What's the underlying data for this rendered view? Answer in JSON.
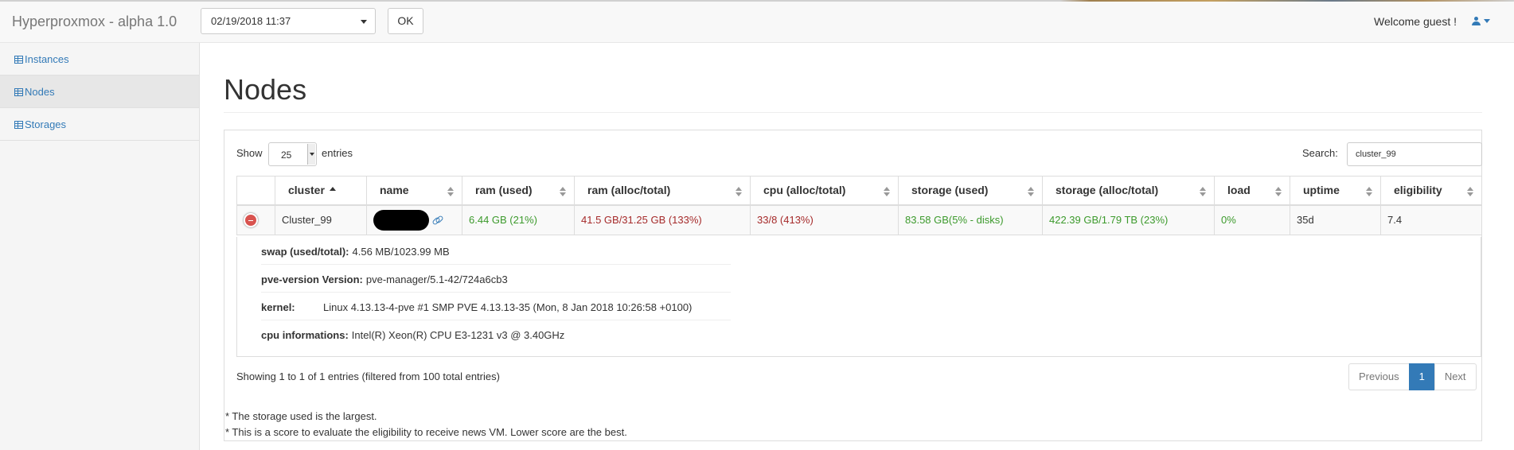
{
  "app": {
    "title": "Hyperproxmox - alpha 1.0"
  },
  "toolbar": {
    "date_value": "02/19/2018 11:37",
    "ok_label": "OK"
  },
  "user": {
    "welcome": "Welcome guest !"
  },
  "sidebar": {
    "items": [
      {
        "label": "Instances",
        "icon": "table-icon"
      },
      {
        "label": "Nodes",
        "icon": "table-icon",
        "active": true
      },
      {
        "label": "Storages",
        "icon": "table-icon"
      }
    ]
  },
  "page": {
    "title": "Nodes"
  },
  "table_controls": {
    "show_label": "Show",
    "length_value": "25",
    "entries_label": "entries",
    "search_label": "Search:",
    "search_value": "cluster_99"
  },
  "table": {
    "columns": [
      "cluster",
      "name",
      "ram (used)",
      "ram (alloc/total)",
      "cpu (alloc/total)",
      "storage (used)",
      "storage (alloc/total)",
      "load",
      "uptime",
      "eligibility"
    ],
    "sorted_column": "cluster",
    "rows": [
      {
        "cluster": "Cluster_99",
        "ram_used": "6.44 GB (21%)",
        "ram_alloc": "41.5 GB/31.25 GB (133%)",
        "cpu_alloc": "33/8 (413%)",
        "storage_used": "83.58 GB(5% - disks)",
        "storage_alloc": "422.39 GB/1.79 TB (23%)",
        "load": "0%",
        "uptime": "35d",
        "eligibility": "7.4"
      }
    ],
    "details": {
      "swap_label": "swap (used/total):",
      "swap_value": "4.56 MB/1023.99 MB",
      "pve_label": "pve-version Version:",
      "pve_value": "pve-manager/5.1-42/724a6cb3",
      "kernel_label": "kernel:",
      "kernel_value": "Linux 4.13.13-4-pve #1 SMP PVE 4.13.13-35 (Mon, 8 Jan 2018 10:26:58 +0100)",
      "cpu_label": "cpu informations:",
      "cpu_value": "Intel(R) Xeon(R) CPU E3-1231 v3 @ 3.40GHz"
    }
  },
  "footer": {
    "info": "Showing 1 to 1 of 1 entries (filtered from 100 total entries)",
    "previous": "Previous",
    "page": "1",
    "next": "Next"
  },
  "notes": [
    "* The storage used is the largest.",
    "* This is a score to evaluate the eligibility to receive news VM. Lower score are the best."
  ],
  "colors": {
    "accent": "#337ab7",
    "good": "#3c9a2c",
    "bad": "#a52a2a",
    "remove": "#d9534f"
  }
}
